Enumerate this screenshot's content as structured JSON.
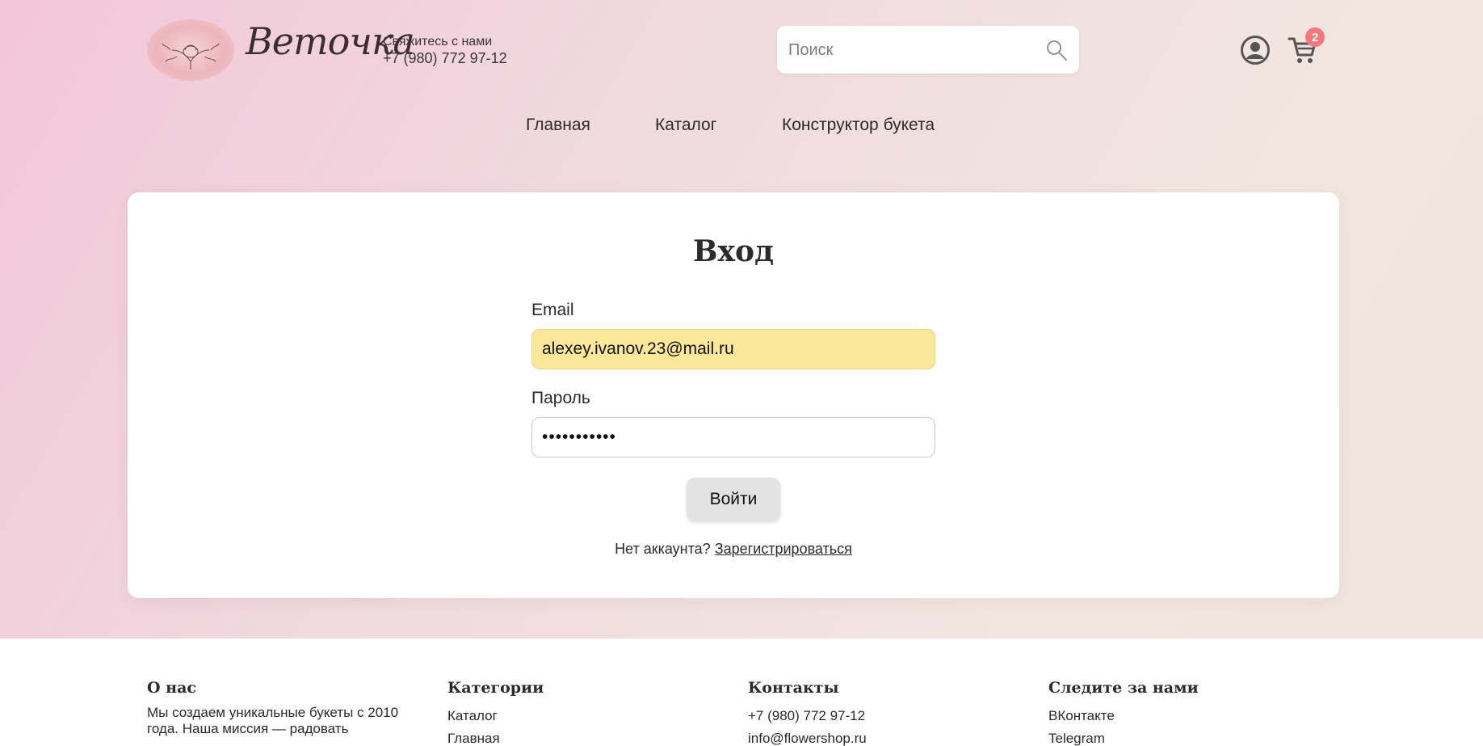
{
  "header": {
    "logo_text": "Веточка",
    "contact_label": "Свяжитесь с нами",
    "contact_phone": "+7 (980) 772 97-12",
    "search_placeholder": "Поиск",
    "cart_count": "2"
  },
  "nav": {
    "items": [
      "Главная",
      "Каталог",
      "Конструктор букета"
    ]
  },
  "login": {
    "title": "Вход",
    "email_label": "Email",
    "email_value": "alexey.ivanov.23@mail.ru",
    "password_label": "Пароль",
    "password_value": "•••••••••••",
    "submit_label": "Войти",
    "no_account_text": "Нет аккаунта?",
    "register_link": "Зарегистрироваться"
  },
  "footer": {
    "about": {
      "heading": "О нас",
      "text": "Мы создаем уникальные букеты с 2010 года. Наша миссия — радовать"
    },
    "categories": {
      "heading": "Категории",
      "links": [
        "Каталог",
        "Главная"
      ]
    },
    "contacts": {
      "heading": "Контакты",
      "phone": "+7 (980) 772 97-12",
      "email": "info@flowershop.ru"
    },
    "social": {
      "heading": "Следите за нами",
      "links": [
        "ВКонтакте",
        "Telegram"
      ]
    }
  },
  "colors": {
    "accent_badge": "#f2787e",
    "autofill_field": "#fde89a",
    "button_bg": "#e3e3e3"
  },
  "icons": [
    "logo-flower-icon",
    "search-icon",
    "user-icon",
    "cart-icon"
  ]
}
